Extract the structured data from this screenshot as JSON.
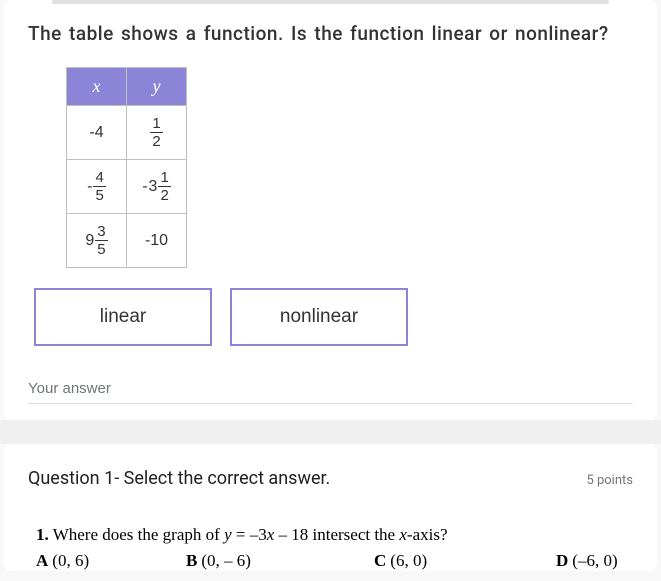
{
  "question1": {
    "prompt": "The table shows a function. Is the function linear or nonlinear?",
    "table": {
      "headers": {
        "x": "x",
        "y": "y"
      },
      "rows": [
        {
          "x": {
            "neg": "-",
            "whole": "4"
          },
          "y": {
            "num": "1",
            "den": "2"
          }
        },
        {
          "x": {
            "neg": "-",
            "num": "4",
            "den": "5"
          },
          "y": {
            "neg": "-",
            "whole": "3",
            "num": "1",
            "den": "2"
          }
        },
        {
          "x": {
            "whole": "9",
            "num": "3",
            "den": "5"
          },
          "y": {
            "neg": "-",
            "whole": "10"
          }
        }
      ]
    },
    "options": {
      "linear": "linear",
      "nonlinear": "nonlinear"
    },
    "answer_placeholder": "Your answer"
  },
  "question2": {
    "title": "Question 1- Select the correct answer.",
    "points": "5 points",
    "number": "1.",
    "stem_pre": "Where does the graph of ",
    "eq_y": "y",
    "eq_eq": " = ",
    "eq_rhs": "–3",
    "eq_x": "x",
    "eq_tail": " – 18 intersect the ",
    "eq_xaxis": "x",
    "eq_end": "-axis?",
    "choices": {
      "A": {
        "label": "A",
        "val": "(0, 6)"
      },
      "B": {
        "label": "B",
        "val": "(0, – 6)"
      },
      "C": {
        "label": "C",
        "val": "(6, 0)"
      },
      "D": {
        "label": "D",
        "val": "(–6, 0)"
      }
    }
  }
}
